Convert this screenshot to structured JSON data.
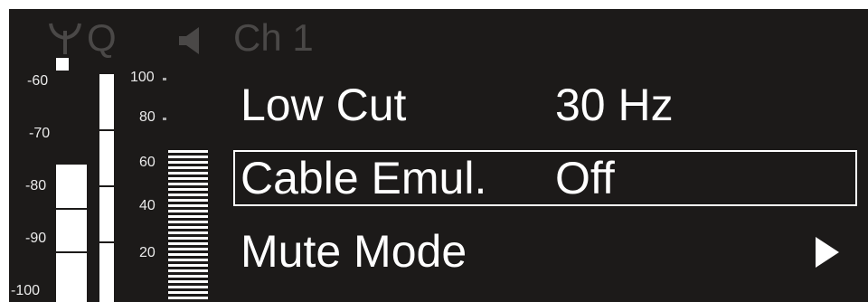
{
  "status_bar": {
    "antenna_icon": "antenna-icon",
    "quality_letter": "Q",
    "speaker_icon": "speaker-icon",
    "channel": "Ch 1"
  },
  "meters": {
    "left_scale": [
      "-60",
      "-70",
      "-80",
      "-90",
      "-100"
    ],
    "right_scale": [
      "100",
      "80",
      "60",
      "40",
      "20"
    ]
  },
  "menu": {
    "items": [
      {
        "label": "Low Cut",
        "value": "30 Hz",
        "selected": false
      },
      {
        "label": "Cable Emul.",
        "value": "Off",
        "selected": true
      },
      {
        "label": "Mute Mode",
        "value": "",
        "selected": false,
        "icon": "play-arrow-icon"
      }
    ]
  },
  "colors": {
    "background": "#1c1a19",
    "foreground": "#ffffff",
    "dim": "#4a4847"
  }
}
